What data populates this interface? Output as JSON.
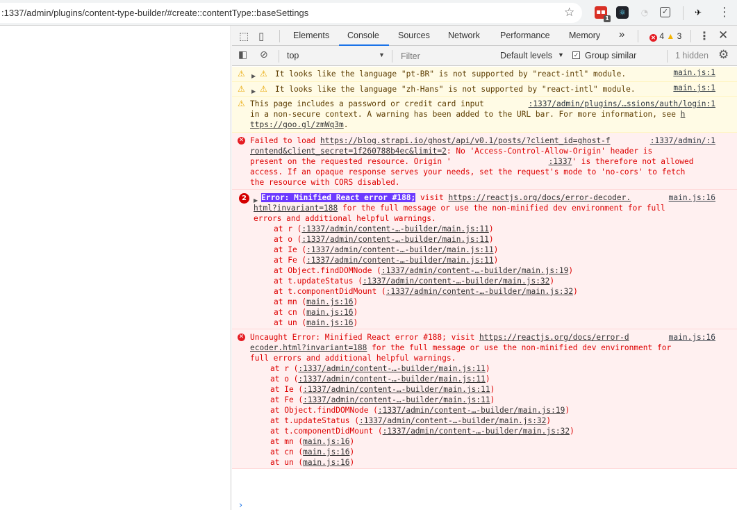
{
  "browser": {
    "url": ":1337/admin/plugins/content-type-builder/#create::contentType::baseSettings",
    "ext_badge": "1"
  },
  "devtools": {
    "tabs": [
      "Elements",
      "Console",
      "Sources",
      "Network",
      "Performance",
      "Memory"
    ],
    "more_tabs": "»",
    "errors_count": "4",
    "warnings_count": "3",
    "context": "top",
    "filter_placeholder": "Filter",
    "levels_label": "Default levels",
    "group_similar": "Group similar",
    "hidden_count": "1 hidden"
  },
  "messages": {
    "w1": {
      "text": "It looks like the language \"pt-BR\" is not supported by \"react-intl\" module.",
      "source": "main.js:1"
    },
    "w2": {
      "text": "It looks like the language \"zh-Hans\" is not supported by \"react-intl\" module.",
      "source": "main.js:1"
    },
    "w3": {
      "l1": "This page includes a password or credit card input",
      "source": ":1337/admin/plugins/…ssions/auth/login:1",
      "l2a": "in a non-secure context. A warning has been added to the URL bar. For more information, see ",
      "l2b": "h",
      "l3": "ttps://goo.gl/zmWq3m",
      "l3end": "."
    },
    "e1": {
      "l1a": "Failed to load ",
      "l1b": "https://blog.strapi.io/ghost/api/v0.1/posts/?client_id=ghost-f",
      "source": ":1337/admin/:1",
      "l2a": "rontend&client_secret=1f260788b4ec&limit=2",
      "l2b": ": No 'Access-Control-Allow-Origin' header is",
      "l3": "present on the requested resource. Origin '",
      "l3b": ":1337",
      "l3c": "' is therefore not allowed",
      "l4": "access. If an opaque response serves your needs, set the request's mode to 'no-cors' to fetch",
      "l5": "the resource with CORS disabled."
    },
    "e2": {
      "count": "2",
      "head": "Error: Minified React error #188;",
      "visit": " visit ",
      "link": "https://reactjs.org/docs/error-decoder.",
      "source": "main.js:16",
      "l2a": "html?invariant=188",
      "l2b": " for the full message or use the non-minified dev environment for full",
      "l3": "errors and additional helpful warnings.",
      "stack": [
        {
          "fn": "at r (",
          "loc": ":1337/admin/content-…-builder/main.js:11",
          "end": ")"
        },
        {
          "fn": "at o (",
          "loc": ":1337/admin/content-…-builder/main.js:11",
          "end": ")"
        },
        {
          "fn": "at Ie (",
          "loc": ":1337/admin/content-…-builder/main.js:11",
          "end": ")"
        },
        {
          "fn": "at Fe (",
          "loc": ":1337/admin/content-…-builder/main.js:11",
          "end": ")"
        },
        {
          "fn": "at Object.findDOMNode (",
          "loc": ":1337/admin/content-…-builder/main.js:19",
          "end": ")"
        },
        {
          "fn": "at t.updateStatus (",
          "loc": ":1337/admin/content-…-builder/main.js:32",
          "end": ")"
        },
        {
          "fn": "at t.componentDidMount (",
          "loc": ":1337/admin/content-…-builder/main.js:32",
          "end": ")"
        },
        {
          "fn": "at mn (",
          "loc": "main.js:16",
          "end": ")"
        },
        {
          "fn": "at cn (",
          "loc": "main.js:16",
          "end": ")"
        },
        {
          "fn": "at un (",
          "loc": "main.js:16",
          "end": ")"
        }
      ]
    },
    "e3": {
      "l1a": "Uncaught Error: Minified React error #188; visit ",
      "l1b": "https://reactjs.org/docs/error-d",
      "source": "main.js:16",
      "l2a": "ecoder.html?invariant=188",
      "l2b": " for the full message or use the non-minified dev environment for",
      "l3": "full errors and additional helpful warnings.",
      "stack": [
        {
          "fn": "at r (",
          "loc": ":1337/admin/content-…-builder/main.js:11",
          "end": ")"
        },
        {
          "fn": "at o (",
          "loc": ":1337/admin/content-…-builder/main.js:11",
          "end": ")"
        },
        {
          "fn": "at Ie (",
          "loc": ":1337/admin/content-…-builder/main.js:11",
          "end": ")"
        },
        {
          "fn": "at Fe (",
          "loc": ":1337/admin/content-…-builder/main.js:11",
          "end": ")"
        },
        {
          "fn": "at Object.findDOMNode (",
          "loc": ":1337/admin/content-…-builder/main.js:19",
          "end": ")"
        },
        {
          "fn": "at t.updateStatus (",
          "loc": ":1337/admin/content-…-builder/main.js:32",
          "end": ")"
        },
        {
          "fn": "at t.componentDidMount (",
          "loc": ":1337/admin/content-…-builder/main.js:32",
          "end": ")"
        },
        {
          "fn": "at mn (",
          "loc": "main.js:16",
          "end": ")"
        },
        {
          "fn": "at cn (",
          "loc": "main.js:16",
          "end": ")"
        },
        {
          "fn": "at un (",
          "loc": "main.js:16",
          "end": ")"
        }
      ]
    }
  },
  "colors": {
    "accent": "#1a73e8",
    "error": "#d00",
    "warning_bg": "#fffbe5",
    "error_bg": "#fff0f0"
  },
  "icons": [
    "inspect-icon",
    "device-icon",
    "star-icon",
    "gear-icon",
    "clear-console-icon",
    "sidebar-icon",
    "close-icon",
    "kebab-menu-icon"
  ]
}
